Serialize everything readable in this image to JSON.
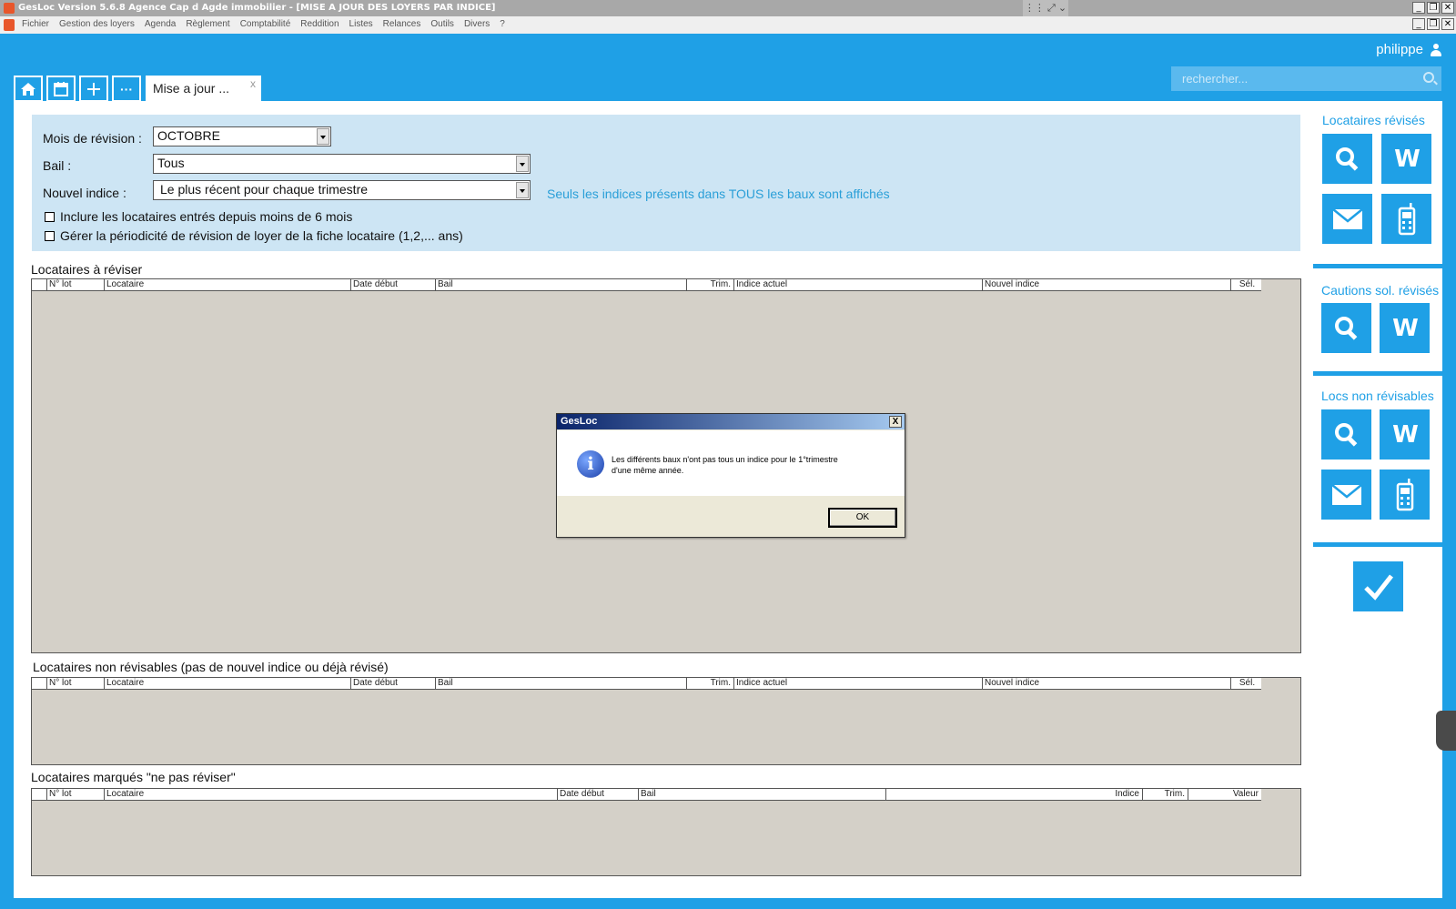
{
  "window": {
    "title": "GesLoc  Version 5.6.8  Agence Cap d Agde immobilier - [MISE A JOUR DES LOYERS PAR INDICE]"
  },
  "menu": [
    "Fichier",
    "Gestion des loyers",
    "Agenda",
    "Règlement",
    "Comptabilité",
    "Reddition",
    "Listes",
    "Relances",
    "Outils",
    "Divers",
    "?"
  ],
  "header": {
    "user": "philippe",
    "search_placeholder": "rechercher..."
  },
  "tabs": {
    "active_label": "Mise a jour ...",
    "close_label": "x",
    "more_label": "···"
  },
  "filters": {
    "mois_label": "Mois de révision :",
    "mois_value": "OCTOBRE",
    "bail_label": "Bail :",
    "bail_value": "Tous",
    "indice_label": "Nouvel indice :",
    "indice_value": "Le plus récent pour chaque trimestre",
    "hint": "Seuls les indices présents dans TOUS les baux sont affichés",
    "checkbox1": "Inclure les locataires entrés depuis moins de 6 mois",
    "checkbox2": "Gérer la périodicité de révision de loyer de la fiche locataire (1,2,... ans)"
  },
  "sections": {
    "a_reviser": "Locataires à réviser",
    "non_revisables": "Locataires non révisables (pas de nouvel indice ou déjà révisé)",
    "ne_pas_reviser": "Locataires marqués \"ne pas réviser\""
  },
  "columns_main": [
    "N° lot",
    "Locataire",
    "Date début",
    "Bail",
    "Trim.",
    "Indice actuel",
    "Nouvel indice",
    "Sél."
  ],
  "columns_marked": [
    "N° lot",
    "Locataire",
    "Date début",
    "Bail",
    "",
    "Indice",
    "Trim.",
    "Valeur"
  ],
  "right_panel": {
    "revises_title": "Locataires révisés",
    "cautions_title": "Cautions sol. révisés",
    "non_revisables_title": "Locs non révisables"
  },
  "dialog": {
    "title": "GesLoc",
    "close": "X",
    "message_line1": "Les différents baux n'ont pas tous un indice pour le 1°trimestre",
    "message_line2": "d'une même année.",
    "ok": "OK"
  },
  "colors": {
    "brand_blue": "#1fa0e6",
    "filter_bg": "#cde5f4",
    "grid_bg": "#d4d0c8"
  }
}
